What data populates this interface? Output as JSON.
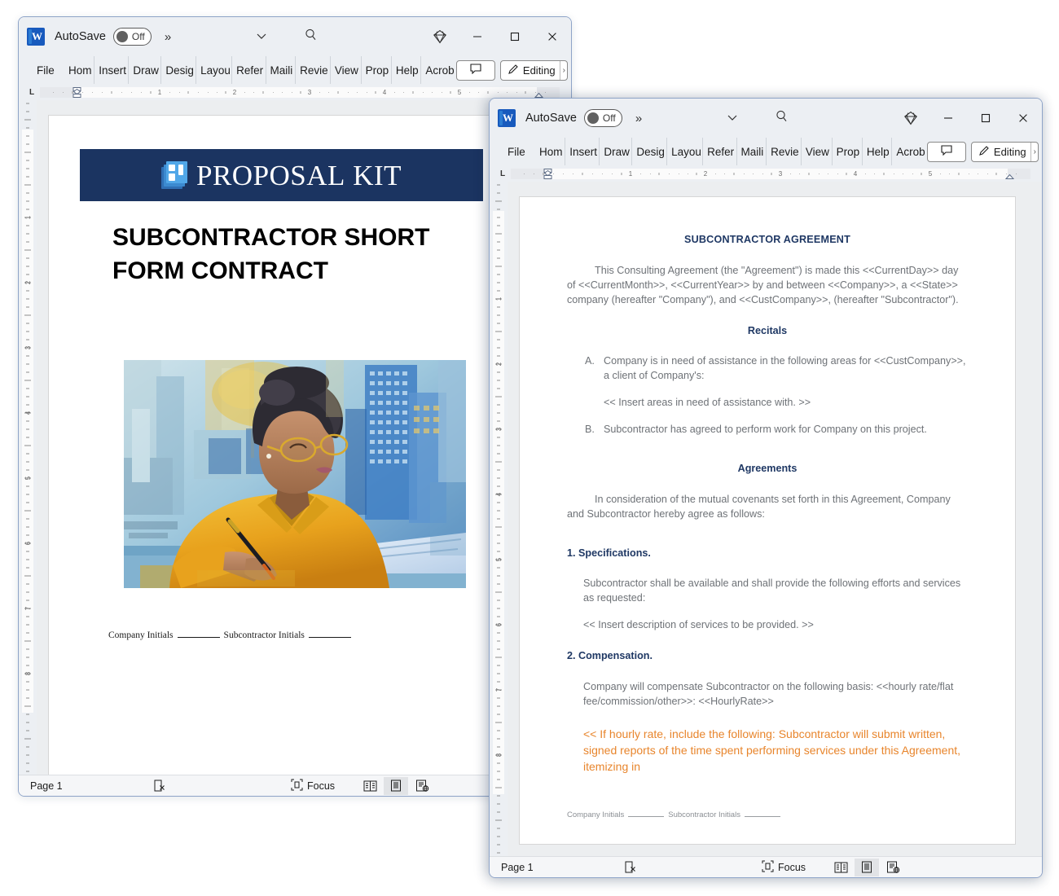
{
  "windows": [
    {
      "id": "word-window-1",
      "titlebar": {
        "app_icon": "word-logo-icon",
        "app_icon_letter": "W",
        "autosave_label": "AutoSave",
        "autosave_state": "Off",
        "more_commands": "»",
        "customize_caret": "chevron-down-icon",
        "search_icon": "search-icon",
        "copilot_icon": "copilot-diamond-icon",
        "minimize": "—",
        "maximize": "□",
        "close": "✕"
      },
      "ribbon": {
        "tabs": [
          "File",
          "Home",
          "Insert",
          "Draw",
          "Design",
          "Layout",
          "Refer",
          "Mailings",
          "Review",
          "View",
          "Proposal",
          "Help",
          "Acrobat"
        ],
        "tabs_visible": [
          "File",
          "Hom",
          "Insert",
          "Draw",
          "Desig",
          "Layou",
          "Refer",
          "Maili",
          "Revie",
          "View",
          "Prop",
          "Help",
          "Acrob"
        ],
        "comment_button": "comment-icon",
        "editing_button": "Editing",
        "editing_caret": "›"
      },
      "ruler": {
        "tab_stop_marker": "L",
        "h_labels": [
          "1",
          "2",
          "3",
          "4",
          "5"
        ],
        "v_labels": [
          "1",
          "2",
          "3",
          "4",
          "5",
          "6",
          "7",
          "8"
        ]
      },
      "statusbar": {
        "page": "Page 1",
        "accessibility_icon": "accessibility-checker-icon",
        "focus_label": "Focus",
        "views": [
          "read-mode-icon",
          "print-layout-icon",
          "web-layout-icon"
        ],
        "active_view_index": 1
      },
      "document": {
        "banner": {
          "brand_primary": "PROPOSAL",
          "brand_secondary": "KIT",
          "bg_color": "#1b3461",
          "logo_icon": "proposal-kit-stacked-pages-icon"
        },
        "title": "SUBCONTRACTOR SHORT FORM CONTRACT",
        "illustration_alt": "Painterly illustration of a woman in a yellow shirt writing on documents at a desk with a blue city skyline behind her",
        "footer": {
          "company_label": "Company Initials",
          "subcontractor_label": "Subcontractor Initials"
        }
      }
    },
    {
      "id": "word-window-2",
      "titlebar": {
        "app_icon": "word-logo-icon",
        "app_icon_letter": "W",
        "autosave_label": "AutoSave",
        "autosave_state": "Off",
        "more_commands": "»",
        "customize_caret": "chevron-down-icon",
        "search_icon": "search-icon",
        "copilot_icon": "copilot-diamond-icon",
        "minimize": "—",
        "maximize": "□",
        "close": "✕"
      },
      "ribbon": {
        "tabs": [
          "File",
          "Home",
          "Insert",
          "Draw",
          "Design",
          "Layout",
          "Refer",
          "Mailings",
          "Review",
          "View",
          "Proposal",
          "Help",
          "Acrobat"
        ],
        "tabs_visible": [
          "File",
          "Hom",
          "Insert",
          "Draw",
          "Desig",
          "Layou",
          "Refer",
          "Maili",
          "Revie",
          "View",
          "Prop",
          "Help",
          "Acrob"
        ],
        "comment_button": "comment-icon",
        "editing_button": "Editing",
        "editing_caret": "›"
      },
      "ruler": {
        "tab_stop_marker": "L",
        "h_labels": [
          "1",
          "2",
          "3",
          "4",
          "5"
        ],
        "v_labels": [
          "1",
          "2",
          "3",
          "4",
          "5",
          "6",
          "7",
          "8"
        ]
      },
      "statusbar": {
        "page": "Page 1",
        "accessibility_icon": "accessibility-checker-icon",
        "focus_label": "Focus",
        "views": [
          "read-mode-icon",
          "print-layout-icon",
          "web-layout-icon"
        ],
        "active_view_index": 1
      },
      "document": {
        "heading": "SUBCONTRACTOR AGREEMENT",
        "intro": "This Consulting Agreement (the \"Agreement\") is made this <<CurrentDay>> day of <<CurrentMonth>>, <<CurrentYear>> by and between <<Company>>, a <<State>> company (hereafter \"Company\"), and <<CustCompany>>, (hereafter \"Subcontractor\").",
        "recitals_heading": "Recitals",
        "recital_a_mark": "A.",
        "recital_a": "Company is in need of assistance in the following areas for <<CustCompany>>, a client of Company's:",
        "recital_a_insert": "<< Insert areas in need of assistance with. >>",
        "recital_b_mark": "B.",
        "recital_b": "Subcontractor has agreed to perform work for Company on this project.",
        "agreements_heading": "Agreements",
        "agreements_intro": "In consideration of the mutual covenants set forth in this Agreement, Company and Subcontractor hereby agree as follows:",
        "section1_heading": "1. Specifications.",
        "section1_body": "Subcontractor shall be available and shall provide the following efforts and services as requested:",
        "section1_insert": "<< Insert description of services to be provided. >>",
        "section2_heading": "2. Compensation.",
        "section2_body": "Company will compensate Subcontractor on the following basis: <<hourly rate/flat fee/commission/other>>: <<HourlyRate>>",
        "section2_note": "<< If hourly rate, include the following: Subcontractor will submit written, signed reports of the time spent performing services under this Agreement, itemizing in",
        "note_color": "#e8852c",
        "heading_color": "#1f3864",
        "footer": {
          "company_label": "Company Initials",
          "subcontractor_label": "Subcontractor Initials"
        }
      }
    }
  ]
}
